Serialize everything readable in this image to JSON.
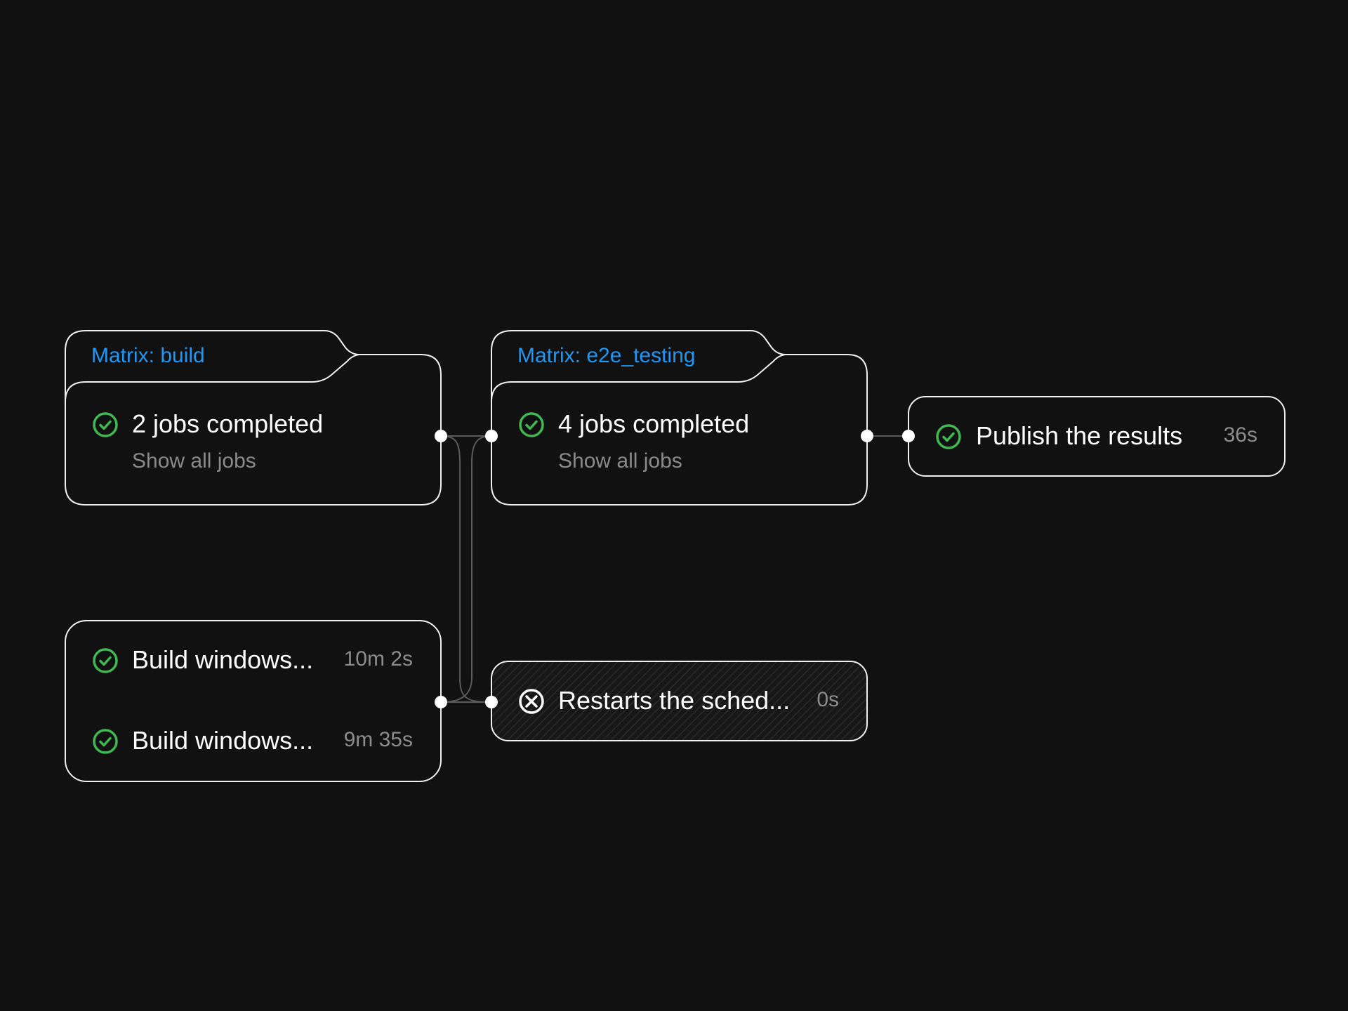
{
  "colors": {
    "background": "#111111",
    "accent": "#2196f3",
    "success": "#3fb950",
    "border": "#f0f0f0",
    "muted": "#8a8a8a",
    "connector": "#5a5a5a"
  },
  "matrix_build": {
    "label": "Matrix: build",
    "summary": "2 jobs completed",
    "show_all": "Show all jobs",
    "status_icon": "check-circle-icon",
    "jobs": [
      {
        "name": "Build windows...",
        "duration": "10m 2s",
        "status_icon": "check-circle-icon"
      },
      {
        "name": "Build windows...",
        "duration": "9m 35s",
        "status_icon": "check-circle-icon"
      }
    ]
  },
  "matrix_e2e": {
    "label": "Matrix: e2e_testing",
    "summary": "4 jobs completed",
    "show_all": "Show all jobs",
    "status_icon": "check-circle-icon"
  },
  "publish": {
    "name": "Publish the results",
    "duration": "36s",
    "status_icon": "check-circle-icon"
  },
  "restart": {
    "name": "Restarts the sched...",
    "duration": "0s",
    "status_icon": "x-circle-icon"
  }
}
